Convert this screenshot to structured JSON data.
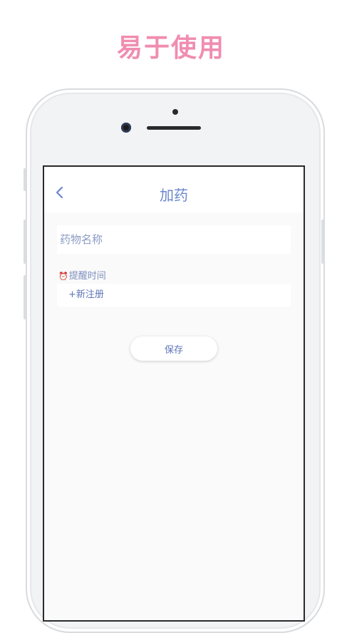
{
  "headline": "易于使用",
  "app": {
    "nav": {
      "title": "加药"
    },
    "form": {
      "drug_name_placeholder": "药物名称",
      "reminder_label": "提醒时间",
      "add_new_label": "+新注册",
      "save_label": "保存"
    }
  },
  "colors": {
    "headline": "#f08db0",
    "accent": "#6b86cc",
    "text_secondary": "#7d8fbf",
    "screen_bg": "#fafafa"
  },
  "icons": {
    "back": "chevron-left-icon",
    "reminder": "alarm-clock-icon"
  }
}
